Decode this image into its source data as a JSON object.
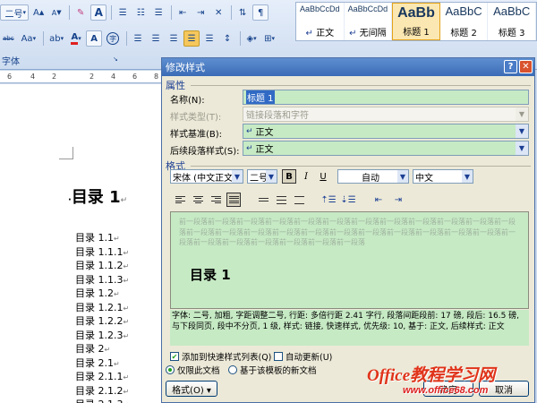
{
  "ribbon": {
    "font_size_value": "二号",
    "font_group_label": "字体",
    "buttons": {
      "grow_font": "A",
      "shrink_font": "A",
      "clear_format": "Aa",
      "font_color": "A",
      "char_border": "A",
      "enclose": "字",
      "change_case": "Aa",
      "strikethrough": "abc"
    },
    "styles": [
      {
        "sample": "AaBbCcDd",
        "name": "正文",
        "icon": "paragraph-mark",
        "active": false
      },
      {
        "sample": "AaBbCcDd",
        "name": "无间隔",
        "icon": "paragraph-mark",
        "active": false
      },
      {
        "sample": "AaBb",
        "name": "标题 1",
        "active": true
      },
      {
        "sample": "AaBbC",
        "name": "标题 2",
        "active": false
      },
      {
        "sample": "AaBbC",
        "name": "标题 3",
        "active": false
      }
    ],
    "ruler_numbers": [
      "6",
      "4",
      "2",
      "2",
      "4",
      "6",
      "8"
    ]
  },
  "document": {
    "heading": "目录 1",
    "heading_mark": "↵",
    "items": [
      "目录 1.1",
      "目录 1.1.1",
      "目录 1.1.2",
      "目录 1.1.3",
      "目录 1.2",
      "目录 1.2.1",
      "目录 1.2.2",
      "目录 1.2.3",
      "目录 2",
      "目录 2.1",
      "目录 2.1.1",
      "目录 2.1.2",
      "目录 2.1.3"
    ],
    "item_mark": "↵"
  },
  "dialog": {
    "title": "修改样式",
    "help_button": "?",
    "close_button": "✕",
    "properties_section": "属性",
    "name_label": "名称(N):",
    "name_value": "标题 1",
    "style_type_label": "样式类型(T):",
    "style_type_value": "链接段落和字符",
    "based_on_label": "样式基准(B):",
    "based_on_value": "正文",
    "next_style_label": "后续段落样式(S):",
    "next_style_value": "正文",
    "format_section": "格式",
    "font_name": "宋体 (中文正文)",
    "font_size": "二号",
    "bold": "B",
    "italic": "I",
    "underline": "U",
    "color_value": "自动",
    "language_value": "中文",
    "preview_filler": "前一段落前一段落前一段落前一段落前一段落前一段落前一段落前一段落前一段落前一段落前一段落前一段落前一段落前一段落前一段落前一段落前一段落前一段落前一段落前一段落前一段落前一段落前一段落前一段落前一段落前一段落前一段落前一段落前一段落前一段落",
    "preview_heading": "目录 1",
    "description": "字体: 二号, 加粗, 字距调整二号, 行距: 多倍行距 2.41 字行, 段落间距段前: 17 磅, 段后: 16.5 磅, 与下段同页, 段中不分页, 1 级, 样式: 链接, 快速样式, 优先级: 10, 基于: 正文, 后续样式: 正文",
    "add_to_quick_styles": "添加到快速样式列表(Q)",
    "add_to_quick_styles_checked": true,
    "auto_update": "自动更新(U)",
    "auto_update_checked": false,
    "only_this_doc": "仅限此文档",
    "new_docs_template": "基于该模板的新文档",
    "format_button": "格式(O) ▾",
    "ok_button": "确定",
    "cancel_button": "取消"
  },
  "watermark": {
    "logo": "Office教程学习网",
    "url": "www.office68.com"
  }
}
